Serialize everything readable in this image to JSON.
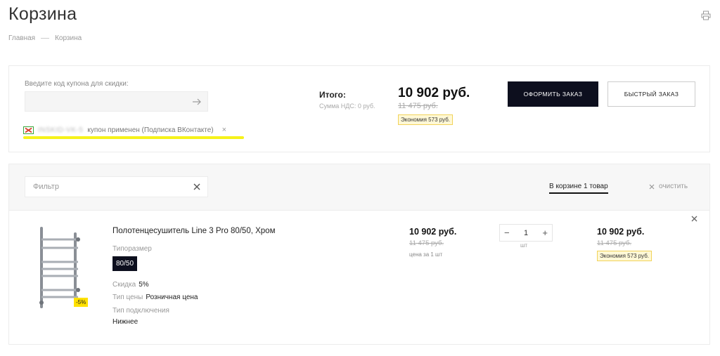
{
  "page": {
    "title": "Корзина"
  },
  "breadcrumb": {
    "home": "Главная",
    "current": "Корзина"
  },
  "coupon": {
    "label": "Введите код купона для скидки:",
    "applied_code": "INSKID-VK-5",
    "applied_text": "купон применен (Подписка ВКонтакте)",
    "remove_symbol": "×"
  },
  "summary": {
    "total_label": "Итого:",
    "vat_label": "Сумма НДС: 0 руб.",
    "total_price": "10 902 руб.",
    "old_price": "11 475 руб.",
    "savings": "Экономия 573 руб.",
    "order_button": "оформить заказ",
    "quick_order_button": "быстрый заказ"
  },
  "cart": {
    "filter_placeholder": "Фильтр",
    "in_cart": "В корзине 1 товар",
    "clear_all": "очистить",
    "items": [
      {
        "name": "Полотенцесушитель Line 3 Pro 80/50, Хром",
        "discount_badge": "-5%",
        "size_label": "Типоразмер",
        "size_value": "80/50",
        "discount_label": "Скидка",
        "discount_value": "5%",
        "price_type_label": "Тип цены",
        "price_type_value": "Розничная цена",
        "connection_label": "Тип подключения",
        "connection_value": "Нижнее",
        "unit_price": "10 902 руб.",
        "unit_old_price": "11 475 руб.",
        "unit_note": "цена за 1 шт",
        "quantity": "1",
        "quantity_unit": "шт",
        "qty_minus": "−",
        "qty_plus": "+",
        "sum_price": "10 902 руб.",
        "sum_old_price": "11 475 руб.",
        "sum_savings": "Экономия 573 руб."
      }
    ]
  },
  "colors": {
    "accent_dark": "#0d0f1e",
    "savings_bg": "#fff8d6",
    "badge_yellow": "#ffe100",
    "highlight": "#f6f21a"
  },
  "icons": [
    "print-icon",
    "arrow-right-icon",
    "coupon-tag-icon",
    "close-icon",
    "product-image"
  ]
}
